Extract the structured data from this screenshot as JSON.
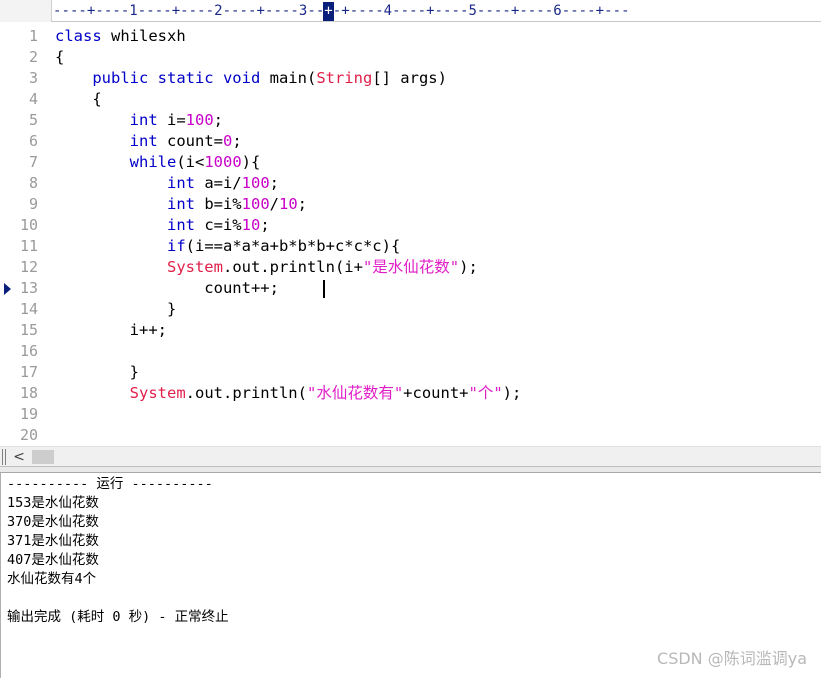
{
  "ruler": {
    "text": "----+----1----+----2----+----3----+----4----+----5----+----6----+---",
    "cursor_char": "+"
  },
  "editor": {
    "current_line": 13,
    "lines": [
      {
        "n": "1",
        "segs": [
          [
            "kw",
            "class"
          ],
          [
            "t",
            " whilesxh"
          ]
        ]
      },
      {
        "n": "2",
        "segs": [
          [
            "t",
            "{"
          ]
        ]
      },
      {
        "n": "3",
        "segs": [
          [
            "t",
            "    "
          ],
          [
            "kw",
            "public static void"
          ],
          [
            "t",
            " main("
          ],
          [
            "cls",
            "String"
          ],
          [
            "t",
            "[] args)"
          ]
        ]
      },
      {
        "n": "4",
        "segs": [
          [
            "t",
            "    {"
          ]
        ]
      },
      {
        "n": "5",
        "segs": [
          [
            "t",
            "        "
          ],
          [
            "kw",
            "int"
          ],
          [
            "t",
            " i="
          ],
          [
            "num",
            "100"
          ],
          [
            "t",
            ";"
          ]
        ]
      },
      {
        "n": "6",
        "segs": [
          [
            "t",
            "        "
          ],
          [
            "kw",
            "int"
          ],
          [
            "t",
            " count="
          ],
          [
            "num",
            "0"
          ],
          [
            "t",
            ";"
          ]
        ]
      },
      {
        "n": "7",
        "segs": [
          [
            "t",
            "        "
          ],
          [
            "kw",
            "while"
          ],
          [
            "t",
            "(i<"
          ],
          [
            "num",
            "1000"
          ],
          [
            "t",
            "){"
          ]
        ]
      },
      {
        "n": "8",
        "segs": [
          [
            "t",
            "            "
          ],
          [
            "kw",
            "int"
          ],
          [
            "t",
            " a=i/"
          ],
          [
            "num",
            "100"
          ],
          [
            "t",
            ";"
          ]
        ]
      },
      {
        "n": "9",
        "segs": [
          [
            "t",
            "            "
          ],
          [
            "kw",
            "int"
          ],
          [
            "t",
            " b=i%"
          ],
          [
            "num",
            "100"
          ],
          [
            "t",
            "/"
          ],
          [
            "num",
            "10"
          ],
          [
            "t",
            ";"
          ]
        ]
      },
      {
        "n": "10",
        "segs": [
          [
            "t",
            "            "
          ],
          [
            "kw",
            "int"
          ],
          [
            "t",
            " c=i%"
          ],
          [
            "num",
            "10"
          ],
          [
            "t",
            ";"
          ]
        ]
      },
      {
        "n": "11",
        "segs": [
          [
            "t",
            "            "
          ],
          [
            "kw",
            "if"
          ],
          [
            "t",
            "(i==a*a*a+b*b*b+c*c*c){"
          ]
        ]
      },
      {
        "n": "12",
        "segs": [
          [
            "t",
            "            "
          ],
          [
            "cls",
            "System"
          ],
          [
            "t",
            ".out.println(i+"
          ],
          [
            "str",
            "\"是水仙花数\""
          ],
          [
            "t",
            ");"
          ]
        ]
      },
      {
        "n": "13",
        "segs": [
          [
            "t",
            "                count++;"
          ]
        ]
      },
      {
        "n": "14",
        "segs": [
          [
            "t",
            "            }"
          ]
        ]
      },
      {
        "n": "15",
        "segs": [
          [
            "t",
            "        i++;"
          ]
        ]
      },
      {
        "n": "16",
        "segs": [
          [
            "t",
            ""
          ]
        ]
      },
      {
        "n": "17",
        "segs": [
          [
            "t",
            "        }"
          ]
        ]
      },
      {
        "n": "18",
        "segs": [
          [
            "t",
            "        "
          ],
          [
            "cls",
            "System"
          ],
          [
            "t",
            ".out.println("
          ],
          [
            "str",
            "\"水仙花数有\""
          ],
          [
            "t",
            "+count+"
          ],
          [
            "str",
            "\"个\""
          ],
          [
            "t",
            ");"
          ]
        ]
      },
      {
        "n": "19",
        "segs": [
          [
            "t",
            ""
          ]
        ]
      },
      {
        "n": "20",
        "segs": [
          [
            "t",
            ""
          ]
        ]
      }
    ]
  },
  "scrollbar": {
    "left_arrow": "<"
  },
  "output": {
    "lines": [
      "---------- 运行 ----------",
      "153是水仙花数",
      "370是水仙花数",
      "371是水仙花数",
      "407是水仙花数",
      "水仙花数有4个",
      "",
      "输出完成 (耗时 0 秒) - 正常终止"
    ]
  },
  "watermark": "CSDN @陈词滥调ya",
  "colors": {
    "keyword": "#0000c8",
    "number": "#c800c8",
    "class": "#e0204a",
    "string": "#e01ec8",
    "line_number": "#9a9a9a"
  }
}
